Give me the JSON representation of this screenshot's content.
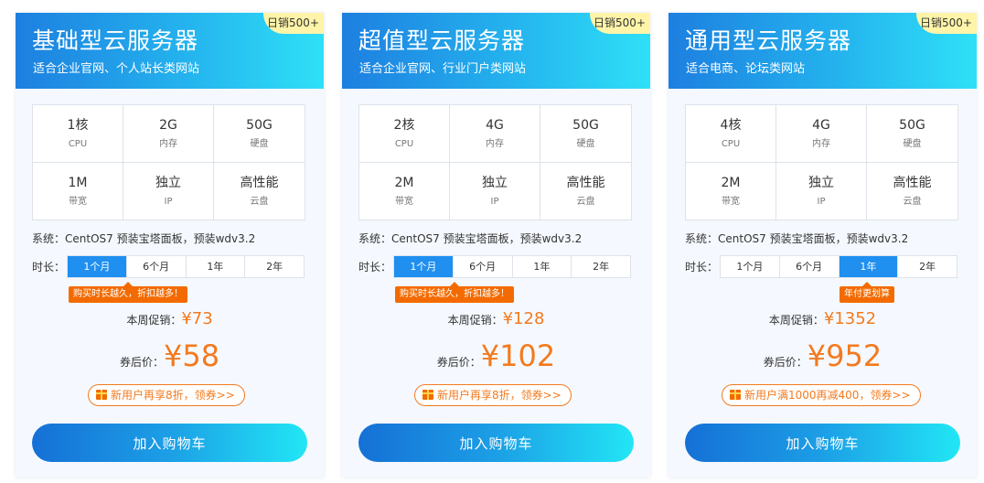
{
  "cards": [
    {
      "title": "基础型云服务器",
      "subtitle": "适合企业官网、个人站长类网站",
      "sales_badge": "日销500+",
      "specs": [
        {
          "value": "1核",
          "label": "CPU"
        },
        {
          "value": "2G",
          "label": "内存"
        },
        {
          "value": "50G",
          "label": "硬盘"
        },
        {
          "value": "1M",
          "label": "带宽"
        },
        {
          "value": "独立",
          "label": "IP"
        },
        {
          "value": "高性能",
          "label": "云盘"
        }
      ],
      "system": "系统：CentOS7 预装宝塔面板，预装wdv3.2",
      "duration_label": "时长：",
      "durations": [
        "1个月",
        "6个月",
        "1年",
        "2年"
      ],
      "selected_duration": "1个月",
      "tip": "购买时长越久，折扣越多！",
      "promo_label": "本周促销：",
      "promo_price": "¥73",
      "coupon_label": "券后价：",
      "coupon_price": "¥58",
      "gift_text": "新用户再享8折，领券>>",
      "cart_button": "加入购物车"
    },
    {
      "title": "超值型云服务器",
      "subtitle": "适合企业官网、行业门户类网站",
      "sales_badge": "日销500+",
      "specs": [
        {
          "value": "2核",
          "label": "CPU"
        },
        {
          "value": "4G",
          "label": "内存"
        },
        {
          "value": "50G",
          "label": "硬盘"
        },
        {
          "value": "2M",
          "label": "带宽"
        },
        {
          "value": "独立",
          "label": "IP"
        },
        {
          "value": "高性能",
          "label": "云盘"
        }
      ],
      "system": "系统：CentOS7 预装宝塔面板，预装wdv3.2",
      "duration_label": "时长：",
      "durations": [
        "1个月",
        "6个月",
        "1年",
        "2年"
      ],
      "selected_duration": "1个月",
      "tip": "购买时长越久，折扣越多！",
      "promo_label": "本周促销：",
      "promo_price": "¥128",
      "coupon_label": "券后价：",
      "coupon_price": "¥102",
      "gift_text": "新用户再享8折，领券>>",
      "cart_button": "加入购物车"
    },
    {
      "title": "通用型云服务器",
      "subtitle": "适合电商、论坛类网站",
      "sales_badge": "日销500+",
      "specs": [
        {
          "value": "4核",
          "label": "CPU"
        },
        {
          "value": "4G",
          "label": "内存"
        },
        {
          "value": "50G",
          "label": "硬盘"
        },
        {
          "value": "2M",
          "label": "带宽"
        },
        {
          "value": "独立",
          "label": "IP"
        },
        {
          "value": "高性能",
          "label": "云盘"
        }
      ],
      "system": "系统：CentOS7 预装宝塔面板，预装wdv3.2",
      "duration_label": "时长：",
      "durations": [
        "1个月",
        "6个月",
        "1年",
        "2年"
      ],
      "selected_duration": "1年",
      "tip": "年付更划算",
      "promo_label": "本周促销：",
      "promo_price": "¥1352",
      "coupon_label": "券后价：",
      "coupon_price": "¥952",
      "gift_text": "新用户满1000再减400，领券>>",
      "cart_button": "加入购物车"
    }
  ],
  "colors": {
    "accent_blue": "#1f8ff0",
    "price_orange": "#f37a1f",
    "tip_orange": "#f36b00",
    "badge_yellow": "#fff4a8"
  },
  "icons": [
    "gift-icon"
  ]
}
